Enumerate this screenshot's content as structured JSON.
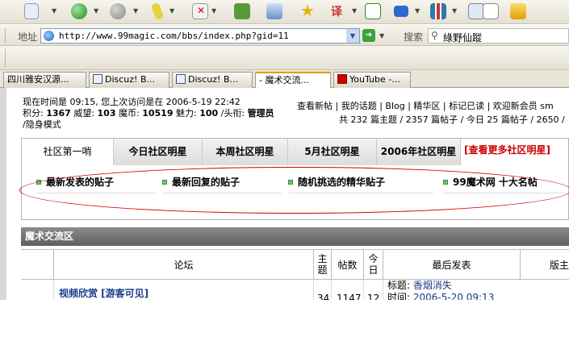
{
  "address_bar": {
    "label": "地址",
    "url": "http://www.99magic.com/bbs/index.php?gid=11"
  },
  "search": {
    "label": "搜索",
    "value": "綠野仙蹤"
  },
  "tabs": [
    {
      "label": "四川雅安汉源..."
    },
    {
      "label": "Discuz! B..."
    },
    {
      "label": "Discuz! B..."
    },
    {
      "label": "- 魔术交流..."
    },
    {
      "label": "YouTube -..."
    }
  ],
  "forum": {
    "meta_line1": "现在时间是 09:15, 您上次访问是在 2006-5-19 22:42",
    "meta_line2_prefix": "积分: ",
    "points": "1367",
    "prestige_label": " 威望: ",
    "prestige": "103",
    "coins_label": " 魔币: ",
    "coins": "10519",
    "charm_label": " 魅力: ",
    "charm": "100",
    "title_label": " /头衔: ",
    "title": "管理员",
    "stealth": " /隐身模式",
    "top_links": "查看新帖 | 我的话题 | Blog | 精华区 | 标记已读 | 欢迎新会员 sm",
    "stats": "共 232 篇主题 / 2357 篇帖子 / 今日 25 篇帖子 / 2650 /"
  },
  "star_tabs": {
    "tabs": [
      "社区第一哨",
      "今日社区明星",
      "本周社区明星",
      "5月社区明星",
      "2006年社区明星"
    ],
    "more": "[查看更多社区明星]"
  },
  "quick_links": [
    "最新发表的贴子",
    "最新回复的贴子",
    "随机挑选的精华贴子",
    "99魔术网 十大名帖"
  ],
  "section": {
    "title": "魔术交流区"
  },
  "table": {
    "headers": [
      "论坛",
      "主题",
      "帖数",
      "今日",
      "最后发表",
      "版主"
    ],
    "row1": {
      "forum": "视频欣赏 [游客可见]",
      "topics": "34",
      "posts": "1147",
      "today": "12",
      "last_title_label": "标题: ",
      "last_title": "香烟消失",
      "last_time_label": "时间: ",
      "last_time": "2006-5-20 09:13"
    }
  }
}
